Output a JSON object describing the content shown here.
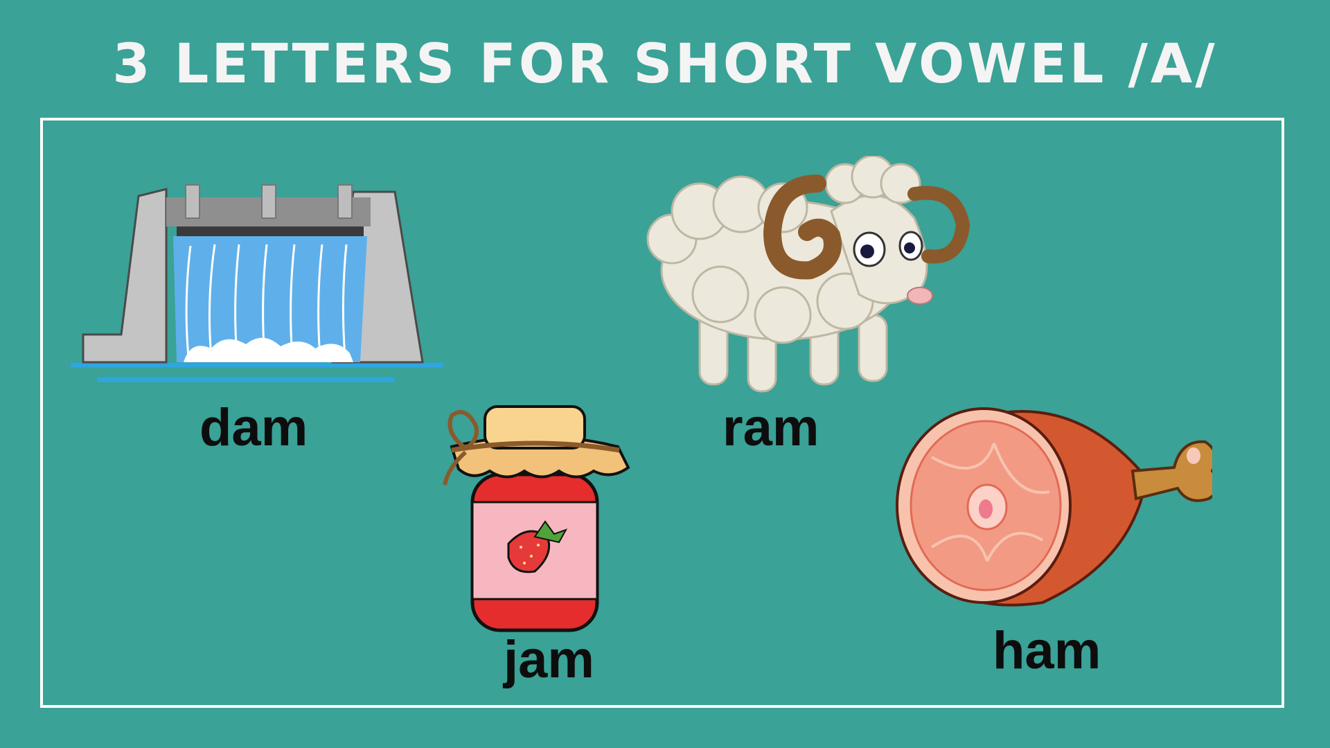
{
  "title": "3 LETTERS FOR SHORT VOWEL /A/",
  "colors": {
    "background": "#3aa296",
    "border": "#ffffff",
    "title_text": "#f4f4f4",
    "word_text": "#0d0d0d"
  },
  "items": [
    {
      "word": "dam",
      "icon": "dam-icon"
    },
    {
      "word": "jam",
      "icon": "jam-jar-icon"
    },
    {
      "word": "ram",
      "icon": "ram-icon"
    },
    {
      "word": "ham",
      "icon": "ham-icon"
    }
  ]
}
